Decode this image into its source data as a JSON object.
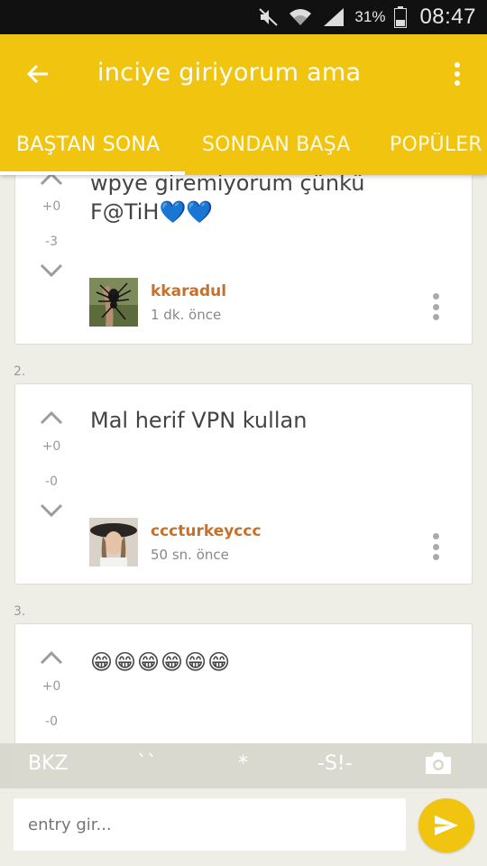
{
  "status_bar": {
    "battery_percent": "31%",
    "clock": "08:47",
    "icons": [
      "mute-icon",
      "wifi-icon",
      "signal-icon",
      "battery-icon"
    ]
  },
  "app_bar": {
    "title": "inciye giriyorum ama",
    "color": "#f1c40f",
    "tabs": [
      {
        "label": "BAŞTAN SONA",
        "active": true
      },
      {
        "label": "SONDAN BAŞA",
        "active": false
      },
      {
        "label": "POPÜLER",
        "active": false
      }
    ]
  },
  "entries": [
    {
      "number": "",
      "text_lines": [
        "wpye giremiyorum çünkü",
        "F@TiH💙💙"
      ],
      "up_count": "+0",
      "down_count": "-3",
      "author": "kkaradul",
      "time": "1 dk. önce"
    },
    {
      "number": "2.",
      "text_lines": [
        "Mal herif VPN kullan"
      ],
      "up_count": "+0",
      "down_count": "-0",
      "author": "cccturkeyccc",
      "time": "50 sn. önce"
    },
    {
      "number": "3.",
      "text_lines": [
        "😁😁😁😁😁😁"
      ],
      "up_count": "+0",
      "down_count": "-0",
      "author": "",
      "time": ""
    }
  ],
  "shortcuts": [
    "BKZ",
    "``",
    "*",
    "-S!-"
  ],
  "composer": {
    "placeholder": "entry gir..."
  }
}
